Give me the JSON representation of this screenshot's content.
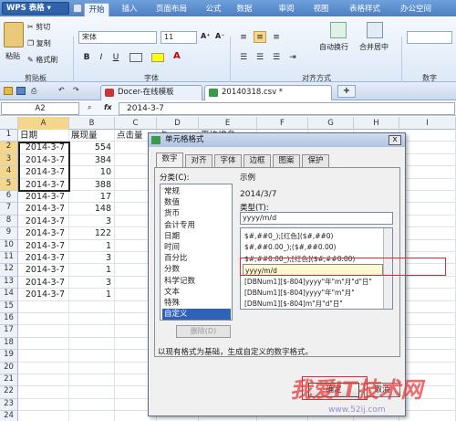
{
  "app": {
    "wps_label": "WPS 表格",
    "tabs": [
      "开始",
      "插入",
      "页面布局",
      "公式",
      "数据",
      "审阅",
      "视图",
      "表格样式",
      "办公空间"
    ],
    "active_tab": "开始"
  },
  "ribbon": {
    "paste": "粘贴",
    "cut": "剪切",
    "copy": "复制",
    "format_painter": "格式刷",
    "clipboard_group": "剪贴板",
    "font_name": "宋体",
    "font_size": "11",
    "bold": "B",
    "italic": "I",
    "underline": "U",
    "font_group": "字体",
    "align_group": "对齐方式",
    "wrap": "自动换行",
    "merge": "合并居中",
    "number_group": "数字",
    "a_plus": "A⁺",
    "a_minus": "A⁻",
    "font_color_a": "A"
  },
  "docs": {
    "tabs": [
      {
        "label": "Docer-在线模板",
        "active": false
      },
      {
        "label": "20140318.csv *",
        "active": true
      }
    ],
    "add_label": "+"
  },
  "formula_bar": {
    "name_box": "A2",
    "fx": "fx",
    "content": "2014-3-7"
  },
  "sheet": {
    "columns": [
      "A",
      "B",
      "C",
      "D",
      "E",
      "F",
      "G",
      "H",
      "I"
    ],
    "row_numbers": [
      "1",
      "2",
      "3",
      "4",
      "5",
      "6",
      "7",
      "8",
      "9",
      "10",
      "11",
      "12",
      "13",
      "14",
      "15",
      "16",
      "17",
      "18",
      "19",
      "20",
      "21",
      "22",
      "23",
      "24"
    ],
    "header": {
      "a": "日期",
      "b": "展现量",
      "c": "点击量",
      "d": "点",
      "e": "平均排名"
    },
    "rows": [
      {
        "a": "2014-3-7",
        "b": "554"
      },
      {
        "a": "2014-3-7",
        "b": "384"
      },
      {
        "a": "2014-3-7",
        "b": "10"
      },
      {
        "a": "2014-3-7",
        "b": "388"
      },
      {
        "a": "2014-3-7",
        "b": "17"
      },
      {
        "a": "2014-3-7",
        "b": "148"
      },
      {
        "a": "2014-3-7",
        "b": "3"
      },
      {
        "a": "2014-3-7",
        "b": "122"
      },
      {
        "a": "2014-3-7",
        "b": "1"
      },
      {
        "a": "2014-3-7",
        "b": "3"
      },
      {
        "a": "2014-3-7",
        "b": "1"
      },
      {
        "a": "2014-3-7",
        "b": "3"
      },
      {
        "a": "2014-3-7",
        "b": "1"
      }
    ]
  },
  "dialog": {
    "title": "单元格格式",
    "close": "x",
    "tabs": [
      "数字",
      "对齐",
      "字体",
      "边框",
      "图案",
      "保护"
    ],
    "active_tab": "数字",
    "category_label": "分类(C):",
    "categories": [
      "常规",
      "数值",
      "货币",
      "会计专用",
      "日期",
      "时间",
      "百分比",
      "分数",
      "科学记数",
      "文本",
      "特殊",
      "自定义"
    ],
    "selected_category": "自定义",
    "sample_label": "示例",
    "sample_value": "2014/3/7",
    "type_label": "类型(T):",
    "type_value": "yyyy/m/d",
    "formats": [
      "$#,##0_);[红色]($#,##0)",
      "$#,##0.00_);($#,##0.00)",
      "$#,##0.00_);[红色]($#,##0.00)",
      "yyyy/m/d",
      "[DBNum1][$-804]yyyy\"年\"m\"月\"d\"日\"",
      "[DBNum1][$-804]yyyy\"年\"m\"月\"",
      "[DBNum1][$-804]m\"月\"d\"日\""
    ],
    "selected_format": "yyyy/m/d",
    "delete_label": "删除(D)",
    "description": "以现有格式为基础，生成自定义的数字格式。",
    "ok_label": "确定",
    "cancel_label": "取消"
  },
  "watermark": {
    "text": "我爱IT技术网",
    "url": "www.52ij.com"
  },
  "colors": {
    "ribbon_blue": "#4d7fc2",
    "selection_blue": "#3063b8",
    "highlight_red": "#e23333"
  }
}
